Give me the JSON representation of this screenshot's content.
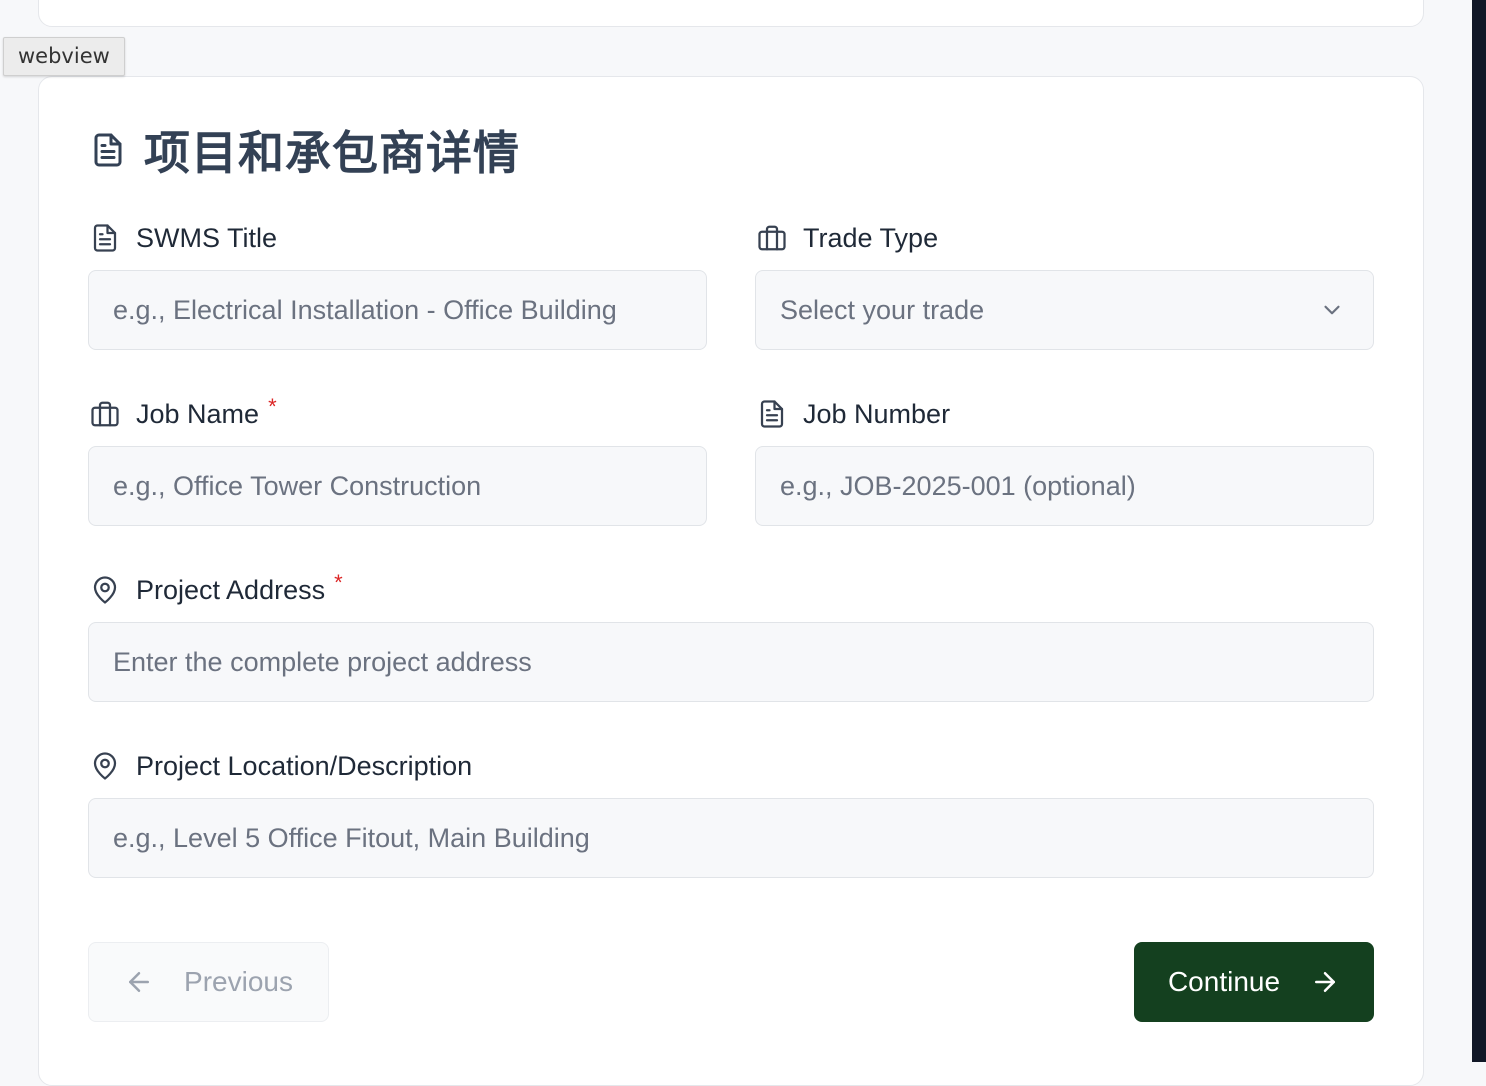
{
  "overlay": {
    "webview_label": "webview"
  },
  "section": {
    "title": "项目和承包商详情"
  },
  "fields": {
    "swms_title": {
      "label": "SWMS Title",
      "placeholder": "e.g., Electrical Installation - Office Building"
    },
    "trade_type": {
      "label": "Trade Type",
      "selected": "Select your trade"
    },
    "job_name": {
      "label": "Job Name",
      "required_mark": "*",
      "placeholder": "e.g., Office Tower Construction"
    },
    "job_number": {
      "label": "Job Number",
      "placeholder": "e.g., JOB-2025-001 (optional)"
    },
    "project_address": {
      "label": "Project Address",
      "required_mark": "*",
      "placeholder": "Enter the complete project address"
    },
    "project_location": {
      "label": "Project Location/Description",
      "placeholder": "e.g., Level 5 Office Fitout, Main Building"
    }
  },
  "nav": {
    "previous_label": "Previous",
    "continue_label": "Continue"
  },
  "icons": {
    "section": "document-icon",
    "swms_title": "document-icon",
    "trade_type": "briefcase-icon",
    "job_name": "briefcase-icon",
    "job_number": "document-icon",
    "project_address": "map-pin-icon",
    "project_location": "map-pin-icon",
    "previous": "arrow-left-icon",
    "continue": "arrow-right-icon",
    "select": "chevron-down-icon"
  },
  "colors": {
    "primary_button": "#14401f",
    "required": "#dc2626",
    "heading": "#334155"
  }
}
